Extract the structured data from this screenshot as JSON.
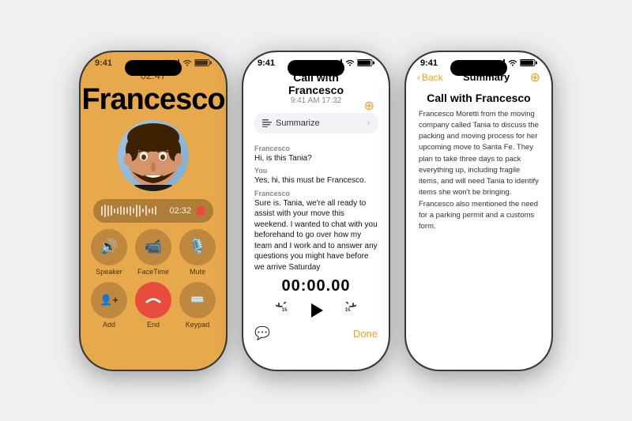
{
  "phone1": {
    "statusBar": {
      "time": "9:41",
      "signal": "▌▌▌",
      "wifi": "wifi",
      "battery": "battery"
    },
    "callDuration": "02:47",
    "callerName": "Francesco",
    "recordingTime": "02:32",
    "buttons": [
      {
        "icon": "🔊",
        "label": "Speaker"
      },
      {
        "icon": "📹",
        "label": "FaceTime"
      },
      {
        "icon": "🎤",
        "label": "Mute"
      },
      {
        "icon": "👤",
        "label": "Add"
      },
      {
        "icon": "📞",
        "label": "End",
        "type": "end"
      },
      {
        "icon": "⌨️",
        "label": "Keypad"
      }
    ]
  },
  "phone2": {
    "statusBar": {
      "time": "9:41",
      "signal": "signal",
      "wifi": "wifi",
      "battery": "battery"
    },
    "header": {
      "title": "Call with Francesco",
      "subtitle": "9:41 AM  17:32"
    },
    "summarizeLabel": "Summarize",
    "messages": [
      {
        "sender": "Francesco",
        "text": "Hi, is this Tania?"
      },
      {
        "sender": "You",
        "text": "Yes, hi, this must be Francesco."
      },
      {
        "sender": "Francesco",
        "text": "Sure is. Tania, we're all ready to assist with your move this weekend. I wanted to chat with you beforehand to go over how my team and I work and to answer any questions you might have before we arrive Saturday"
      }
    ],
    "playbackTime": "00:00.00",
    "doneLabel": "Done"
  },
  "phone3": {
    "statusBar": {
      "time": "9:41",
      "signal": "signal",
      "wifi": "wifi",
      "battery": "battery"
    },
    "nav": {
      "back": "Back",
      "title": "Summary"
    },
    "summary": {
      "title": "Call with Francesco",
      "body": "Francesco Moretti from the moving company called Tania to discuss the packing and moving process for her upcoming move to Santa Fe. They plan to take three days to pack everything up, including fragile items, and will need Tania to identify items she won't be bringing. Francesco also mentioned the need for a parking permit and a customs form."
    }
  }
}
